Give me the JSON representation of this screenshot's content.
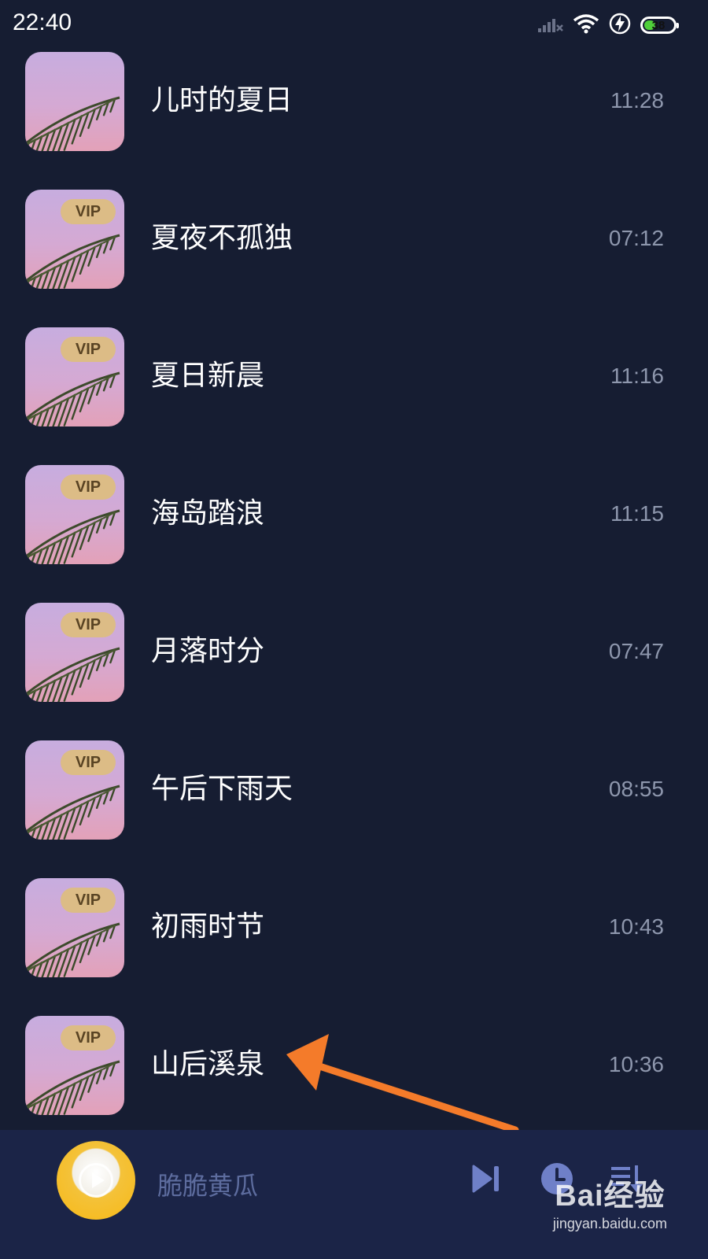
{
  "status_bar": {
    "time": "22:40",
    "battery_level": "38",
    "icons": [
      "signal-icon",
      "wifi-icon",
      "charging-icon",
      "battery-icon"
    ]
  },
  "songs": [
    {
      "title": "儿时的夏日",
      "duration": "11:28",
      "vip": false
    },
    {
      "title": "夏夜不孤独",
      "duration": "07:12",
      "vip": true,
      "vip_label": "VIP"
    },
    {
      "title": "夏日新晨",
      "duration": "11:16",
      "vip": true,
      "vip_label": "VIP"
    },
    {
      "title": "海岛踏浪",
      "duration": "11:15",
      "vip": true,
      "vip_label": "VIP"
    },
    {
      "title": "月落时分",
      "duration": "07:47",
      "vip": true,
      "vip_label": "VIP"
    },
    {
      "title": "午后下雨天",
      "duration": "08:55",
      "vip": true,
      "vip_label": "VIP"
    },
    {
      "title": "初雨时节",
      "duration": "10:43",
      "vip": true,
      "vip_label": "VIP"
    },
    {
      "title": "山后溪泉",
      "duration": "10:36",
      "vip": true,
      "vip_label": "VIP"
    }
  ],
  "player": {
    "title": "脆脆黄瓜",
    "controls": [
      "next-track-icon",
      "timer-clock-icon",
      "playlist-icon"
    ]
  },
  "watermark": {
    "logo": "Bai经验",
    "url": "jingyan.baidu.com"
  },
  "colors": {
    "background": "#161d32",
    "player_bar": "#1b2447",
    "vip_badge": "#dcbc86",
    "annotation_arrow": "#f47b2a",
    "battery_fill": "#4fcf3a"
  }
}
